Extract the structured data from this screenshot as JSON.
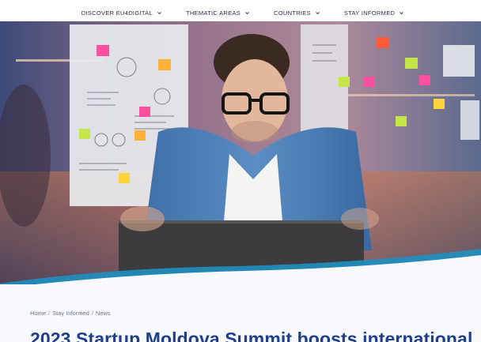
{
  "nav": {
    "items": [
      {
        "label": "DISCOVER EU4DIGITAL"
      },
      {
        "label": "THEMATIC AREAS"
      },
      {
        "label": "COUNTRIES"
      },
      {
        "label": "STAY INFORMED"
      }
    ]
  },
  "breadcrumb": {
    "home": "Home",
    "section": "Stay Informed",
    "current": "News",
    "separator": "/"
  },
  "article": {
    "title": "2023 Startup Moldova Summit boosts international"
  },
  "colors": {
    "title": "#1f3f8a",
    "nav_text": "#2b2b4a",
    "wave_accent": "#1f8fc0"
  }
}
